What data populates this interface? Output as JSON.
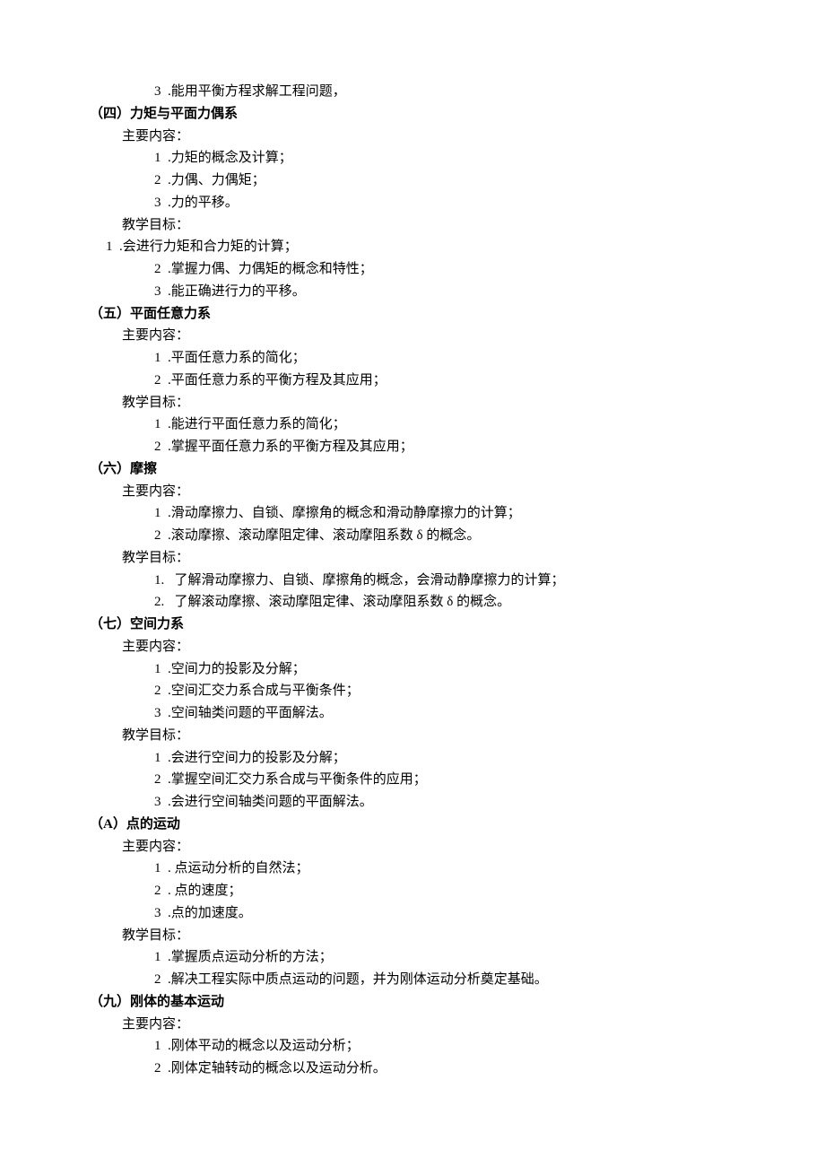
{
  "lines": [
    {
      "indent": "indent-2",
      "bold": false,
      "text": "3  .能用平衡方程求解工程问题，"
    },
    {
      "indent": "indent-0",
      "bold": true,
      "text": "（四）力矩与平面力偶系"
    },
    {
      "indent": "indent-1",
      "bold": false,
      "text": "主要内容："
    },
    {
      "indent": "indent-2",
      "bold": false,
      "text": "1  .力矩的概念及计算；"
    },
    {
      "indent": "indent-2",
      "bold": false,
      "text": "2  .力偶、力偶矩；"
    },
    {
      "indent": "indent-2",
      "bold": false,
      "text": "3  .力的平移。"
    },
    {
      "indent": "indent-1",
      "bold": false,
      "text": "教学目标："
    },
    {
      "indent": "indent-05",
      "bold": false,
      "text": "1  .会进行力矩和合力矩的计算；"
    },
    {
      "indent": "indent-2",
      "bold": false,
      "text": "2  .掌握力偶、力偶矩的概念和特性；"
    },
    {
      "indent": "indent-2",
      "bold": false,
      "text": "3  .能正确进行力的平移。"
    },
    {
      "indent": "indent-0",
      "bold": true,
      "text": "（五）平面任意力系"
    },
    {
      "indent": "indent-1",
      "bold": false,
      "text": "主要内容："
    },
    {
      "indent": "indent-2",
      "bold": false,
      "text": "1  .平面任意力系的简化；"
    },
    {
      "indent": "indent-2",
      "bold": false,
      "text": "2  .平面任意力系的平衡方程及其应用；"
    },
    {
      "indent": "indent-1",
      "bold": false,
      "text": "教学目标："
    },
    {
      "indent": "indent-2",
      "bold": false,
      "text": "1  .能进行平面任意力系的简化；"
    },
    {
      "indent": "indent-2",
      "bold": false,
      "text": "2  .掌握平面任意力系的平衡方程及其应用；"
    },
    {
      "indent": "indent-0",
      "bold": true,
      "text": "（六）摩擦"
    },
    {
      "indent": "indent-1",
      "bold": false,
      "text": "主要内容："
    },
    {
      "indent": "indent-2",
      "bold": false,
      "text": "1  .滑动摩擦力、自锁、摩擦角的概念和滑动静摩擦力的计算；"
    },
    {
      "indent": "indent-2",
      "bold": false,
      "text": "2  .滚动摩擦、滚动摩阻定律、滚动摩阻系数 δ 的概念。"
    },
    {
      "indent": "indent-1",
      "bold": false,
      "text": "教学目标："
    },
    {
      "indent": "indent-2",
      "bold": false,
      "text": "1.   了解滑动摩擦力、自锁、摩擦角的概念，会滑动静摩擦力的计算；"
    },
    {
      "indent": "indent-2",
      "bold": false,
      "text": "2.   了解滚动摩擦、滚动摩阻定律、滚动摩阻系数 δ 的概念。"
    },
    {
      "indent": "indent-0",
      "bold": true,
      "text": "（七）空间力系"
    },
    {
      "indent": "indent-1",
      "bold": false,
      "text": "主要内容："
    },
    {
      "indent": "indent-2",
      "bold": false,
      "text": "1  .空间力的投影及分解；"
    },
    {
      "indent": "indent-2",
      "bold": false,
      "text": "2  .空间汇交力系合成与平衡条件；"
    },
    {
      "indent": "indent-2",
      "bold": false,
      "text": "3  .空间轴类问题的平面解法。"
    },
    {
      "indent": "indent-1",
      "bold": false,
      "text": "教学目标："
    },
    {
      "indent": "indent-2",
      "bold": false,
      "text": "1  .会进行空间力的投影及分解；"
    },
    {
      "indent": "indent-2",
      "bold": false,
      "text": "2  .掌握空间汇交力系合成与平衡条件的应用；"
    },
    {
      "indent": "indent-2",
      "bold": false,
      "text": "3  .会进行空间轴类问题的平面解法。"
    },
    {
      "indent": "indent-0",
      "bold": true,
      "text": "（A）点的运动"
    },
    {
      "indent": "indent-1",
      "bold": false,
      "text": "主要内容："
    },
    {
      "indent": "indent-2",
      "bold": false,
      "text": "1  . 点运动分析的自然法；"
    },
    {
      "indent": "indent-2",
      "bold": false,
      "text": "2  . 点的速度；"
    },
    {
      "indent": "indent-2",
      "bold": false,
      "text": "3  .点的加速度。"
    },
    {
      "indent": "indent-1",
      "bold": false,
      "text": "教学目标："
    },
    {
      "indent": "indent-2",
      "bold": false,
      "text": "1  .掌握质点运动分析的方法；"
    },
    {
      "indent": "indent-2",
      "bold": false,
      "text": "2  .解决工程实际中质点运动的问题，并为刚体运动分析奠定基础。"
    },
    {
      "indent": "indent-0",
      "bold": true,
      "text": "（九）刚体的基本运动"
    },
    {
      "indent": "indent-1",
      "bold": false,
      "text": "主要内容："
    },
    {
      "indent": "indent-2",
      "bold": false,
      "text": "1  .刚体平动的概念以及运动分析；"
    },
    {
      "indent": "indent-2",
      "bold": false,
      "text": "2  .刚体定轴转动的概念以及运动分析。"
    }
  ]
}
